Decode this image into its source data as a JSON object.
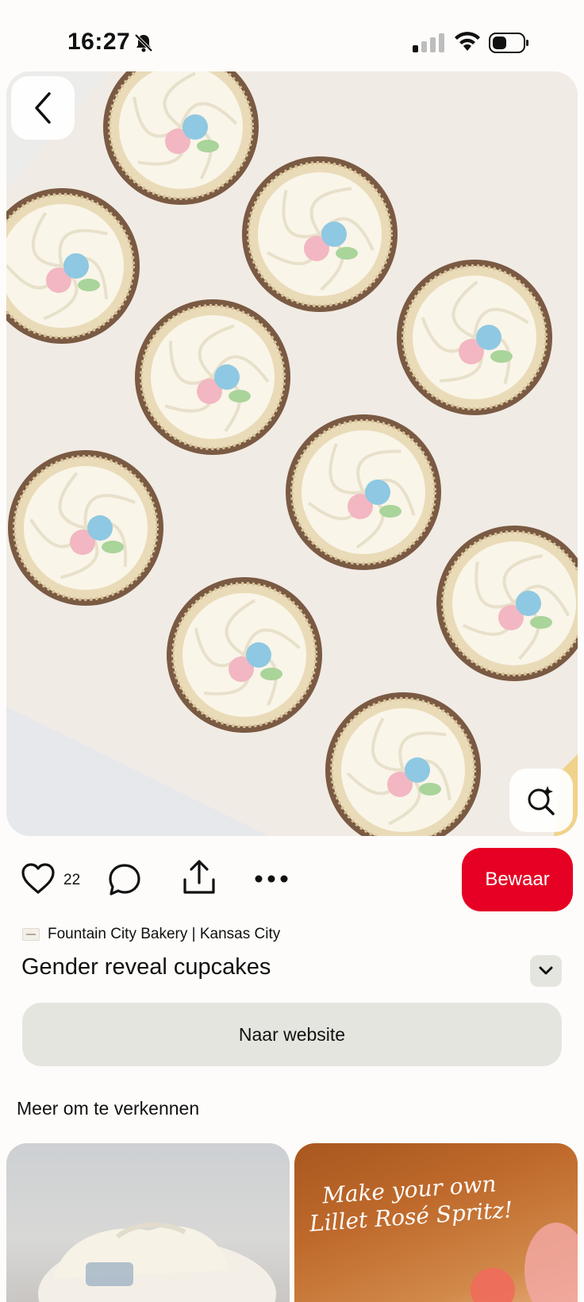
{
  "status_bar": {
    "time": "16:27",
    "icons": [
      "bell-off-icon",
      "signal-icon",
      "wifi-icon",
      "battery-icon"
    ]
  },
  "pin": {
    "image_subject": "cupcakes-photo",
    "like_count": "22",
    "save_label": "Bewaar",
    "source_name": "Fountain City Bakery | Kansas City",
    "title": "Gender reveal cupcakes",
    "website_label": "Naar website"
  },
  "more_section": {
    "heading": "Meer om te verkennen",
    "cards": [
      {
        "image": "cupcake-photo"
      },
      {
        "image": "drink-photo",
        "overlay_text": "Make your own Lillet Rosé Spritz!"
      }
    ]
  },
  "colors": {
    "accent": "#e60023",
    "button_gray": "#e5e5e0"
  }
}
